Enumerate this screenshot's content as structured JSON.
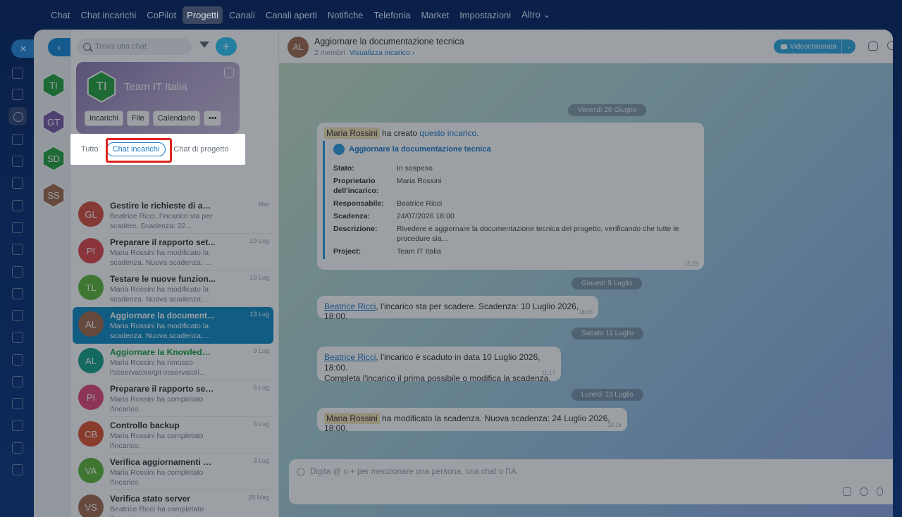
{
  "topnav": [
    "Chat",
    "Chat incarichi",
    "CoPilot",
    "Progetti",
    "Canali",
    "Canali aperti",
    "Notifiche",
    "Telefonia",
    "Market",
    "Impostazioni",
    "Altro ⌄"
  ],
  "topnav_active": "Progetti",
  "rail": {
    "close": "×"
  },
  "projects_rail": [
    {
      "initials": "TI",
      "color": "#27a33f"
    },
    {
      "initials": "GT",
      "color": "#7b5aa8"
    },
    {
      "initials": "SD",
      "color": "#27a33f"
    },
    {
      "initials": "SS",
      "color": "#a46b4e"
    }
  ],
  "search": {
    "placeholder": "Trova una chat"
  },
  "add_label": "+",
  "back_label": "‹",
  "project": {
    "initials": "TI",
    "name": "Team IT Italia",
    "buttons": [
      "Incarichi",
      "File",
      "Calendario",
      "•••"
    ]
  },
  "tabs": [
    "Tutto",
    "Chat incarichi",
    "Chat di progetto"
  ],
  "chats": [
    {
      "initials": "GL",
      "color": "#d9503f",
      "title": "Gestire le richieste di assis...",
      "date": "Mar",
      "preview": "Beatrice Ricci, l'incarico sta per scadere. Scadenza: 22..."
    },
    {
      "initials": "PI",
      "color": "#e0474a",
      "title": "Preparare il rapporto set...",
      "date": "19 Lug",
      "preview": "Maria Rossini ha modificato la scadenza. Nuova scadenza: ..."
    },
    {
      "initials": "TL",
      "color": "#5fb83a",
      "title": "Testare le nuove funzion...",
      "date": "16 Lug",
      "preview": "Maria Rossini ha modificato la scadenza. Nuova scadenza:..."
    },
    {
      "initials": "AL",
      "color": "#a46b4e",
      "title": "Aggiornare la document...",
      "date": "13 Lug",
      "preview": "Maria Rossini ha modificato la scadenza. Nuova scadenza:..."
    },
    {
      "initials": "AL",
      "color": "#16a08a",
      "title": "Aggiornare la Knowledge ...",
      "date": "9 Lug",
      "preview": "Maria Rossini ha rimosso l'osservatore/gli osservatori..."
    },
    {
      "initials": "PI",
      "color": "#e3487d",
      "title": "Preparare il rapporto setti...",
      "date": "5 Lug",
      "preview": "Maria Rossini ha completato l'incarico."
    },
    {
      "initials": "CB",
      "color": "#e0542f",
      "title": "Controllo backup",
      "date": "3 Lug",
      "preview": "Maria Rossini ha completato l'incarico."
    },
    {
      "initials": "VA",
      "color": "#5fb83a",
      "title": "Verifica aggiornamenti di ...",
      "date": "3 Lug",
      "preview": "Maria Rossini ha completato l'incarico."
    },
    {
      "initials": "VS",
      "color": "#a46b4e",
      "title": "Verifica stato server",
      "date": "28 Mag",
      "preview": "Beatrice Ricci ha completato l'incarico."
    }
  ],
  "header": {
    "initials": "AL",
    "title": "Aggiornare la documentazione tecnica",
    "members": "2 membri",
    "view_task": "Visualizza incarico ›",
    "video": "Videochiamata",
    "video_dd": "⌄"
  },
  "dates": [
    "Venerdì 26 Giugno",
    "Giovedì 9 Luglio",
    "Sabato 11 Luglio",
    "Lunedì 13 Luglio"
  ],
  "msg1": {
    "author": "Maria Rossini",
    "text": "ha creato",
    "link": "questo incarico.",
    "time": "15:29",
    "card_title": "Aggiornare la documentazione tecnica",
    "rows": [
      {
        "k": "Stato:",
        "v": "In sospeso"
      },
      {
        "k": "Proprietario dell'incarico:",
        "v": "Maria Rossini"
      },
      {
        "k": "Responsabile:",
        "v": "Beatrice Ricci"
      },
      {
        "k": "Scadenza:",
        "v": "24/07/2026 18:00"
      },
      {
        "k": "Descrizione:",
        "v": "Rivedere e aggiornare la documentazione tecnica del progetto, verificando che tutte le procedure sia..."
      },
      {
        "k": "Project:",
        "v": "Team IT Italia"
      }
    ]
  },
  "msg2": {
    "user": "Beatrice Ricci",
    "text": ", l'incarico sta per scadere. Scadenza: 10 Luglio 2026, 18:00.",
    "time": "18:00"
  },
  "msg3": {
    "user": "Beatrice Ricci",
    "text": ", l'incarico è scaduto in data 10 Luglio 2026, 18:00.",
    "text2": "Completa l'incarico il prima possibile o modifica la scadenza.",
    "time": "11:17"
  },
  "msg4": {
    "user": "Maria Rossini",
    "text": "ha modificato la scadenza. Nuova scadenza: 24 Luglio 2026, 18:00.",
    "time": "10:16"
  },
  "input": {
    "placeholder": "Digita @ o + per menzionare una persona, una chat o l'IA"
  }
}
